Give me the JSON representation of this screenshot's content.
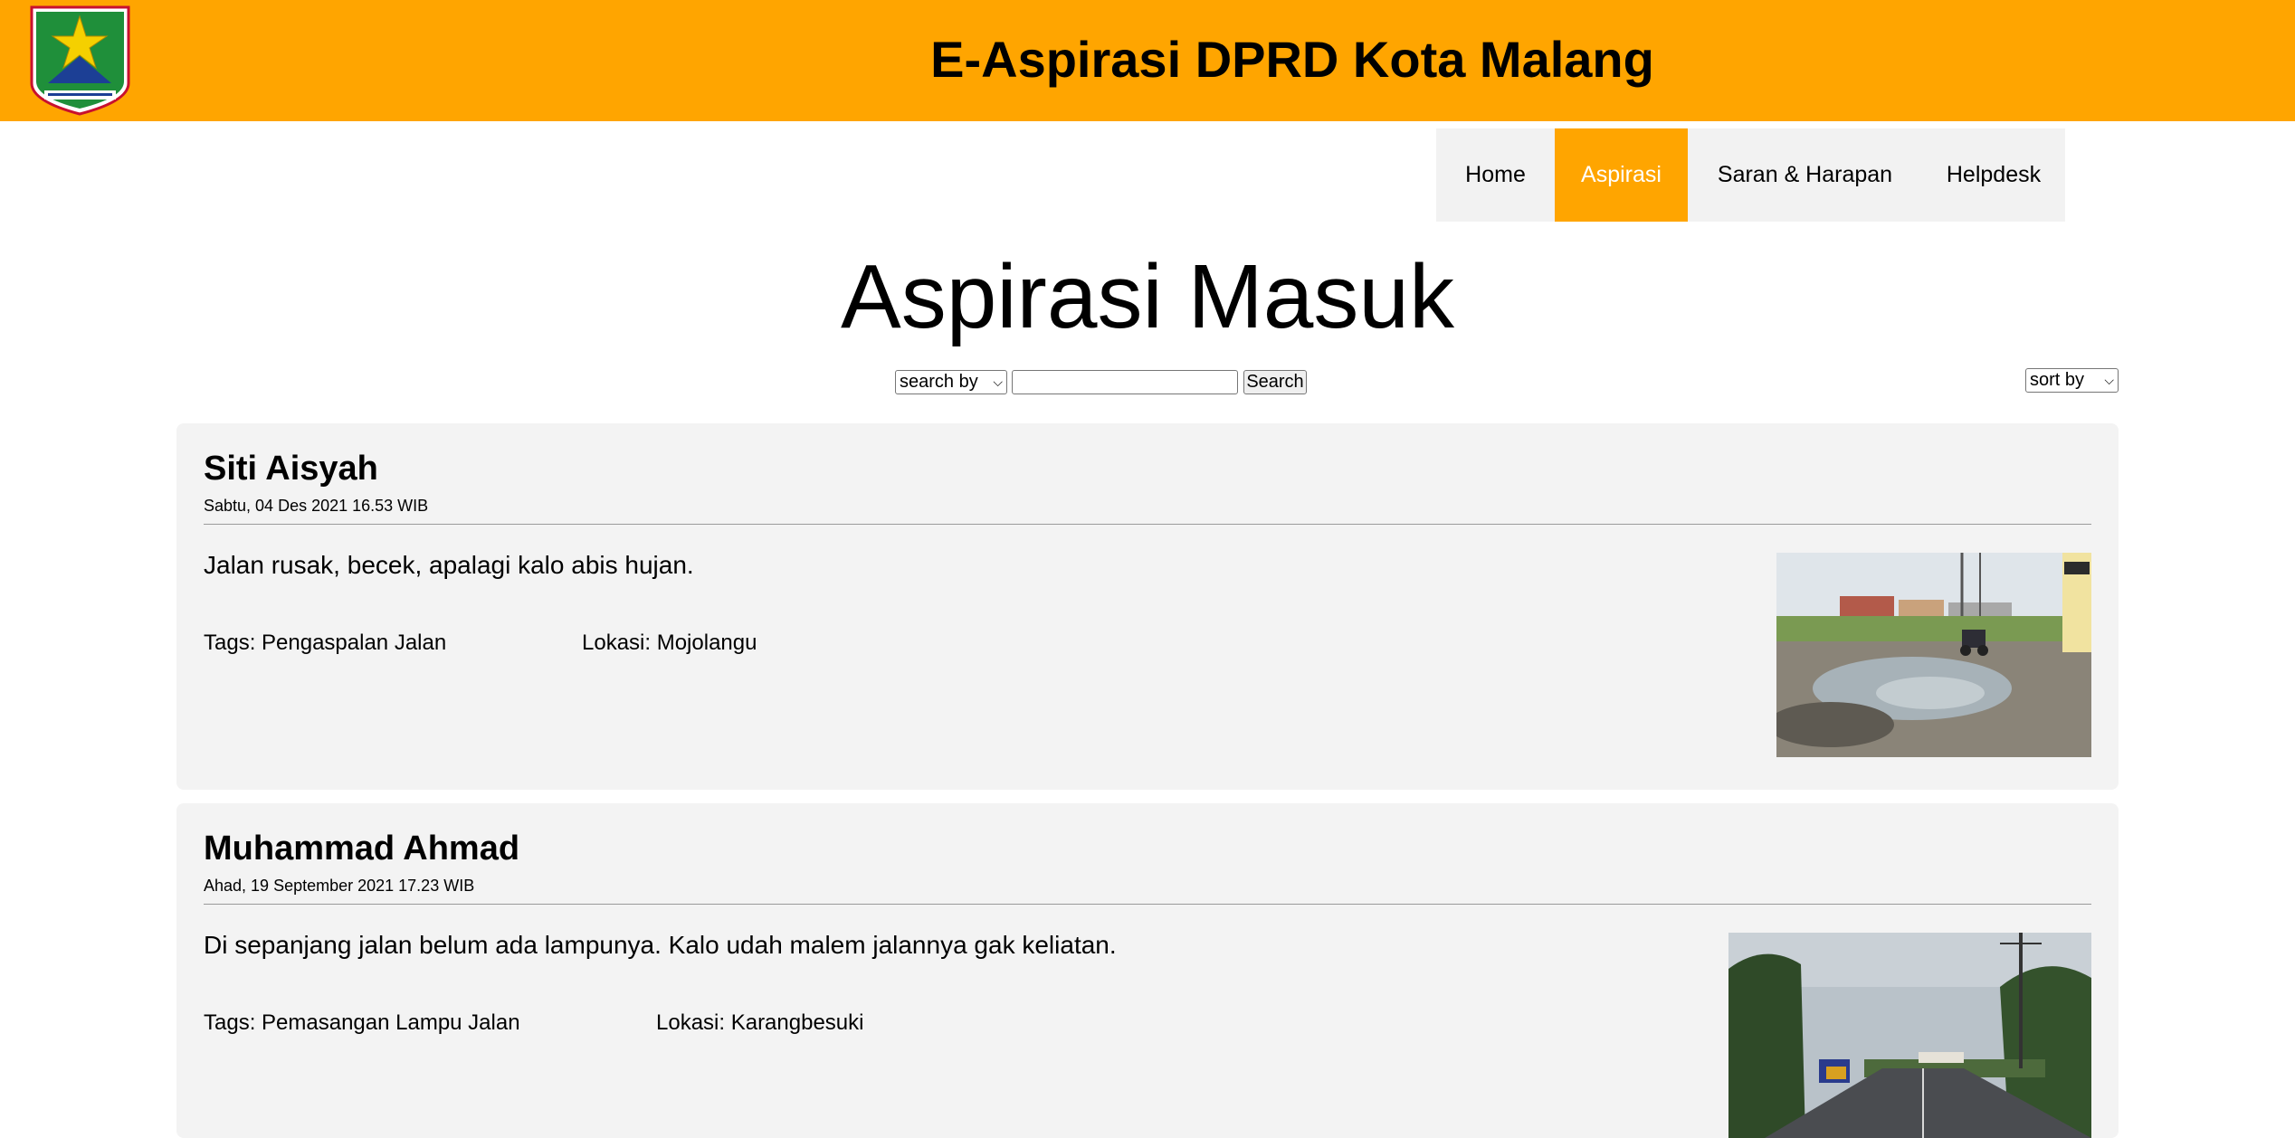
{
  "header": {
    "site_title": "E-Aspirasi DPRD Kota Malang",
    "logo_icon": "malang-city-crest-icon",
    "background_color": "#FFA500"
  },
  "nav": {
    "items": [
      {
        "label": "Home",
        "active": false
      },
      {
        "label": "Aspirasi",
        "active": true
      },
      {
        "label": "Saran & Harapan",
        "active": false
      },
      {
        "label": "Helpdesk",
        "active": false
      }
    ]
  },
  "page_title": "Aspirasi Masuk",
  "search": {
    "search_by_selected": "search by",
    "query_value": "",
    "search_button_label": "Search",
    "sort_by_selected": "sort by"
  },
  "posts": [
    {
      "name": "Siti Aisyah",
      "date": "Sabtu, 04 Des 2021 16.53 WIB",
      "body": "Jalan rusak, becek, apalagi kalo abis hujan.",
      "tags": "Tags: Pengaspalan Jalan",
      "location": "Lokasi: Mojolangu",
      "photo": "damaged-muddy-road-photo"
    },
    {
      "name": "Muhammad Ahmad",
      "date": "Ahad, 19 September 2021 17.23 WIB",
      "body": "Di sepanjang jalan belum ada lampunya. Kalo udah malem jalannya gak keliatan.",
      "tags": "Tags: Pemasangan Lampu Jalan",
      "location": "Lokasi: Karangbesuki",
      "photo": "unlit-roadside-photo"
    }
  ]
}
